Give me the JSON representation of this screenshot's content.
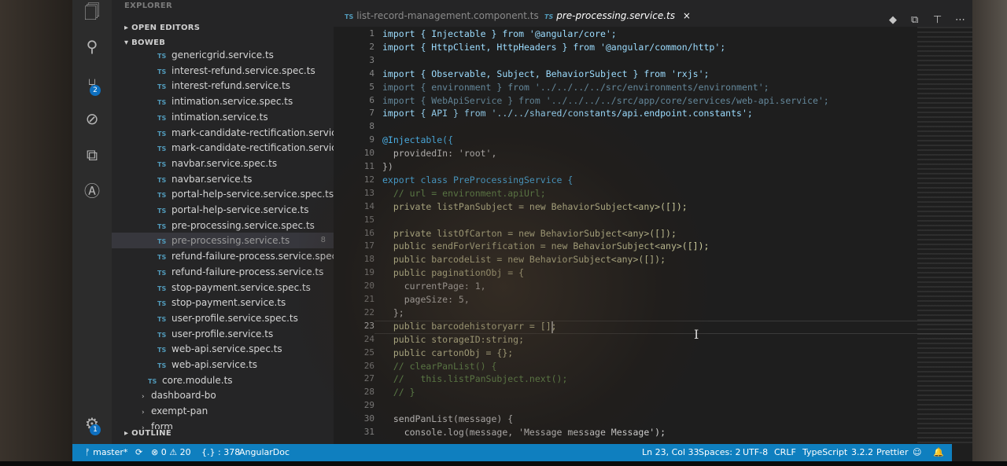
{
  "activity_bar": {
    "icons": [
      "files-icon",
      "search-icon",
      "source-control-icon",
      "debug-icon",
      "extensions-icon",
      "angular-icon",
      "settings-gear-icon"
    ],
    "scm_badge": "2",
    "settings_badge": "1"
  },
  "sidebar": {
    "title": "EXPLORER",
    "open_editors": "OPEN EDITORS",
    "project": "BOWEB",
    "outline": "OUTLINE",
    "files": [
      {
        "label": "genericgrid.service.ts",
        "type": "ts"
      },
      {
        "label": "interest-refund.service.spec.ts",
        "type": "ts"
      },
      {
        "label": "interest-refund.service.ts",
        "type": "ts"
      },
      {
        "label": "intimation.service.spec.ts",
        "type": "ts"
      },
      {
        "label": "intimation.service.ts",
        "type": "ts"
      },
      {
        "label": "mark-candidate-rectification.service.s...",
        "type": "ts"
      },
      {
        "label": "mark-candidate-rectification.service.ts",
        "type": "ts"
      },
      {
        "label": "navbar.service.spec.ts",
        "type": "ts"
      },
      {
        "label": "navbar.service.ts",
        "type": "ts"
      },
      {
        "label": "portal-help-service.service.spec.ts",
        "type": "ts"
      },
      {
        "label": "portal-help-service.service.ts",
        "type": "ts"
      },
      {
        "label": "pre-processing.service.spec.ts",
        "type": "ts"
      },
      {
        "label": "pre-processing.service.ts",
        "type": "ts",
        "active": true,
        "count": "8"
      },
      {
        "label": "refund-failure-process.service.spec.ts",
        "type": "ts"
      },
      {
        "label": "refund-failure-process.service.ts",
        "type": "ts"
      },
      {
        "label": "stop-payment.service.spec.ts",
        "type": "ts"
      },
      {
        "label": "stop-payment.service.ts",
        "type": "ts"
      },
      {
        "label": "user-profile.service.spec.ts",
        "type": "ts"
      },
      {
        "label": "user-profile.service.ts",
        "type": "ts"
      },
      {
        "label": "web-api.service.spec.ts",
        "type": "ts"
      },
      {
        "label": "web-api.service.ts",
        "type": "ts"
      },
      {
        "label": "core.module.ts",
        "type": "ts",
        "indent": "less"
      },
      {
        "label": "dashboard-bo",
        "type": "folder"
      },
      {
        "label": "exempt-pan",
        "type": "folder"
      },
      {
        "label": "form",
        "type": "folder"
      }
    ],
    "ts_label": "TS"
  },
  "tabs": [
    {
      "label": "list-record-management.component.ts",
      "active": false
    },
    {
      "label": "pre-processing.service.ts",
      "active": true,
      "close": "×"
    }
  ],
  "editor": {
    "current_line": "23",
    "lines": [
      {
        "n": "1",
        "t": "import { Injectable } from '@angular/core';"
      },
      {
        "n": "2",
        "t": "import { HttpClient, HttpHeaders } from '@angular/common/http';"
      },
      {
        "n": "3",
        "t": ""
      },
      {
        "n": "4",
        "t": "import { Observable, Subject, BehaviorSubject } from 'rxjs';"
      },
      {
        "n": "5",
        "t": "import { environment } from '../../../../src/environments/environment';"
      },
      {
        "n": "6",
        "t": "import { WebApiService } from '../../../../src/app/core/services/web-api.service';"
      },
      {
        "n": "7",
        "t": "import { API } from '../../shared/constants/api.endpoint.constants';"
      },
      {
        "n": "8",
        "t": ""
      },
      {
        "n": "9",
        "t": "@Injectable({"
      },
      {
        "n": "10",
        "t": "  providedIn: 'root',"
      },
      {
        "n": "11",
        "t": "})"
      },
      {
        "n": "12",
        "t": "export class PreProcessingService {"
      },
      {
        "n": "13",
        "t": "  // url = environment.apiUrl;"
      },
      {
        "n": "14",
        "t": "  private listPanSubject = new BehaviorSubject<any>([]);"
      },
      {
        "n": "15",
        "t": ""
      },
      {
        "n": "16",
        "t": "  private listOfCarton = new BehaviorSubject<any>([]);"
      },
      {
        "n": "17",
        "t": "  public sendForVerification = new BehaviorSubject<any>([]);"
      },
      {
        "n": "18",
        "t": "  public barcodeList = new BehaviorSubject<any>([]);"
      },
      {
        "n": "19",
        "t": "  public paginationObj = {"
      },
      {
        "n": "20",
        "t": "    currentPage: 1,"
      },
      {
        "n": "21",
        "t": "    pageSize: 5,"
      },
      {
        "n": "22",
        "t": "  };"
      },
      {
        "n": "23",
        "t": "  public barcodehistoryarr = [];"
      },
      {
        "n": "24",
        "t": "  public storageID:string;"
      },
      {
        "n": "25",
        "t": "  public cartonObj = {};"
      },
      {
        "n": "26",
        "t": "  // clearPanList() {"
      },
      {
        "n": "27",
        "t": "  //   this.listPanSubject.next();"
      },
      {
        "n": "28",
        "t": "  // }"
      },
      {
        "n": "29",
        "t": ""
      },
      {
        "n": "30",
        "t": "  sendPanList(message) {"
      },
      {
        "n": "31",
        "t": "    console.log(message, 'Message message Message');"
      }
    ]
  },
  "statusbar": {
    "branch": "master*",
    "sync": "⟳",
    "errors": "0",
    "warnings": "20",
    "position_info": "{.} : 378",
    "angular_doc": "AngularDoc",
    "cursor": "Ln 23, Col 33",
    "spaces": "Spaces: 2",
    "encoding": "UTF-8",
    "eol": "CRLF",
    "language": "TypeScript",
    "version": "3.2.2",
    "formatter": "Prettier",
    "feedback": "☺",
    "bell": "🔔"
  },
  "colors": {
    "statusbar": "#0f7fbf",
    "sidebar": "#252526",
    "editor": "#1e1e1e",
    "ts_icon": "#519aba"
  }
}
